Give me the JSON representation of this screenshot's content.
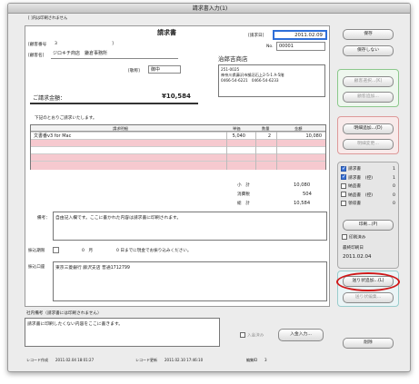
{
  "window": {
    "title": "請求書入力(1)"
  },
  "note_top": "[ ]内は印刷されません",
  "doc": {
    "title": "請求書",
    "customer_no_label": "[顧客番号",
    "customer_no_value": "3",
    "customer_no_close": "]",
    "customer_name_label": "[顧客名]",
    "customer_name_value": "ジロキチ商店　鎌倉事務所",
    "honorific_label": "[敬称]",
    "honorific_value": "御中",
    "amount_label": "ご請求金額：",
    "amount_value": "¥10,584",
    "date_label": "[請求日]",
    "date_value": "2011.02.09",
    "no_label": "No.",
    "no_value": "00001",
    "company": "治郎吉商店",
    "address_lines": [
      "251-0025",
      "神奈川県藤沢市鵠沼石上2-5-1 A-5階",
      "0466-54-6221　0466-54-6233"
    ],
    "intro": "下記のとおりご請求いたします。",
    "table_headers": [
      "請求明細",
      "単価",
      "数量",
      "金額"
    ],
    "rows": [
      {
        "item": "文書番v3 for Mac",
        "price": "5,040",
        "qty": "2",
        "amount": "10,080"
      },
      {
        "item": "",
        "price": "",
        "qty": "",
        "amount": ""
      },
      {
        "item": "",
        "price": "",
        "qty": "",
        "amount": ""
      },
      {
        "item": "",
        "price": "",
        "qty": "",
        "amount": ""
      },
      {
        "item": "",
        "price": "",
        "qty": "",
        "amount": ""
      }
    ],
    "subtotal_label": "小　計",
    "subtotal_value": "10,080",
    "tax_label": "消費税",
    "tax_value": "504",
    "total_label": "総　計",
    "total_value": "10,584",
    "memo_label": "備考：",
    "memo_value": "自由記入欄です。ここに書かれた内容は請求書に印刷されます。",
    "due_label": "振込期限",
    "due_text_1": "0　月",
    "due_text_2": "0 日までに現金でお振り込みください。",
    "bank_label": "振込口座",
    "bank_value": "東京三菱銀行 藤沢支店 普通1712799"
  },
  "internal": {
    "label": "社内備考（請求書には印刷されません）",
    "value": "請求書に印刷したくない内容をここに書きます。",
    "received_label": "入金済み",
    "deposit_button": "入金入力..."
  },
  "footer": {
    "created_label": "レコード作成",
    "created_value": "2011.02.04 18:01:27",
    "updated_label": "レコード更新",
    "updated_value": "2011.02.10 17:46:10",
    "edit_label": "編集ID",
    "edit_value": "3"
  },
  "sidebar": {
    "save": "保存",
    "dont_save": "保存しない",
    "select_customer": "顧客選択...(K)",
    "add_customer": "顧客追加...",
    "add_item": "明細追加...(D)",
    "change_item": "明細変更...",
    "print_items": [
      {
        "label": "請求書",
        "checked": true,
        "count": "1"
      },
      {
        "label": "請求書　(控)",
        "checked": true,
        "count": "1"
      },
      {
        "label": "納品書",
        "checked": false,
        "count": "0"
      },
      {
        "label": "納品書　(控)",
        "checked": false,
        "count": "0"
      },
      {
        "label": "領収書",
        "checked": false,
        "count": "0"
      }
    ],
    "print_button": "印刷...(P)",
    "printed_label": "印刷済み",
    "last_print_label": "最終印刷日",
    "last_print_value": "2011.02.04",
    "add_slip": "送り状追加...(L)",
    "change_slip": "送り状編集...",
    "delete": "削除"
  },
  "colors": {
    "accent_blue": "#2f6fd8",
    "highlight_red": "#d01818",
    "pink_row": "#f6c9cf",
    "green_border": "#8cc88c",
    "red_border": "#d99"
  }
}
